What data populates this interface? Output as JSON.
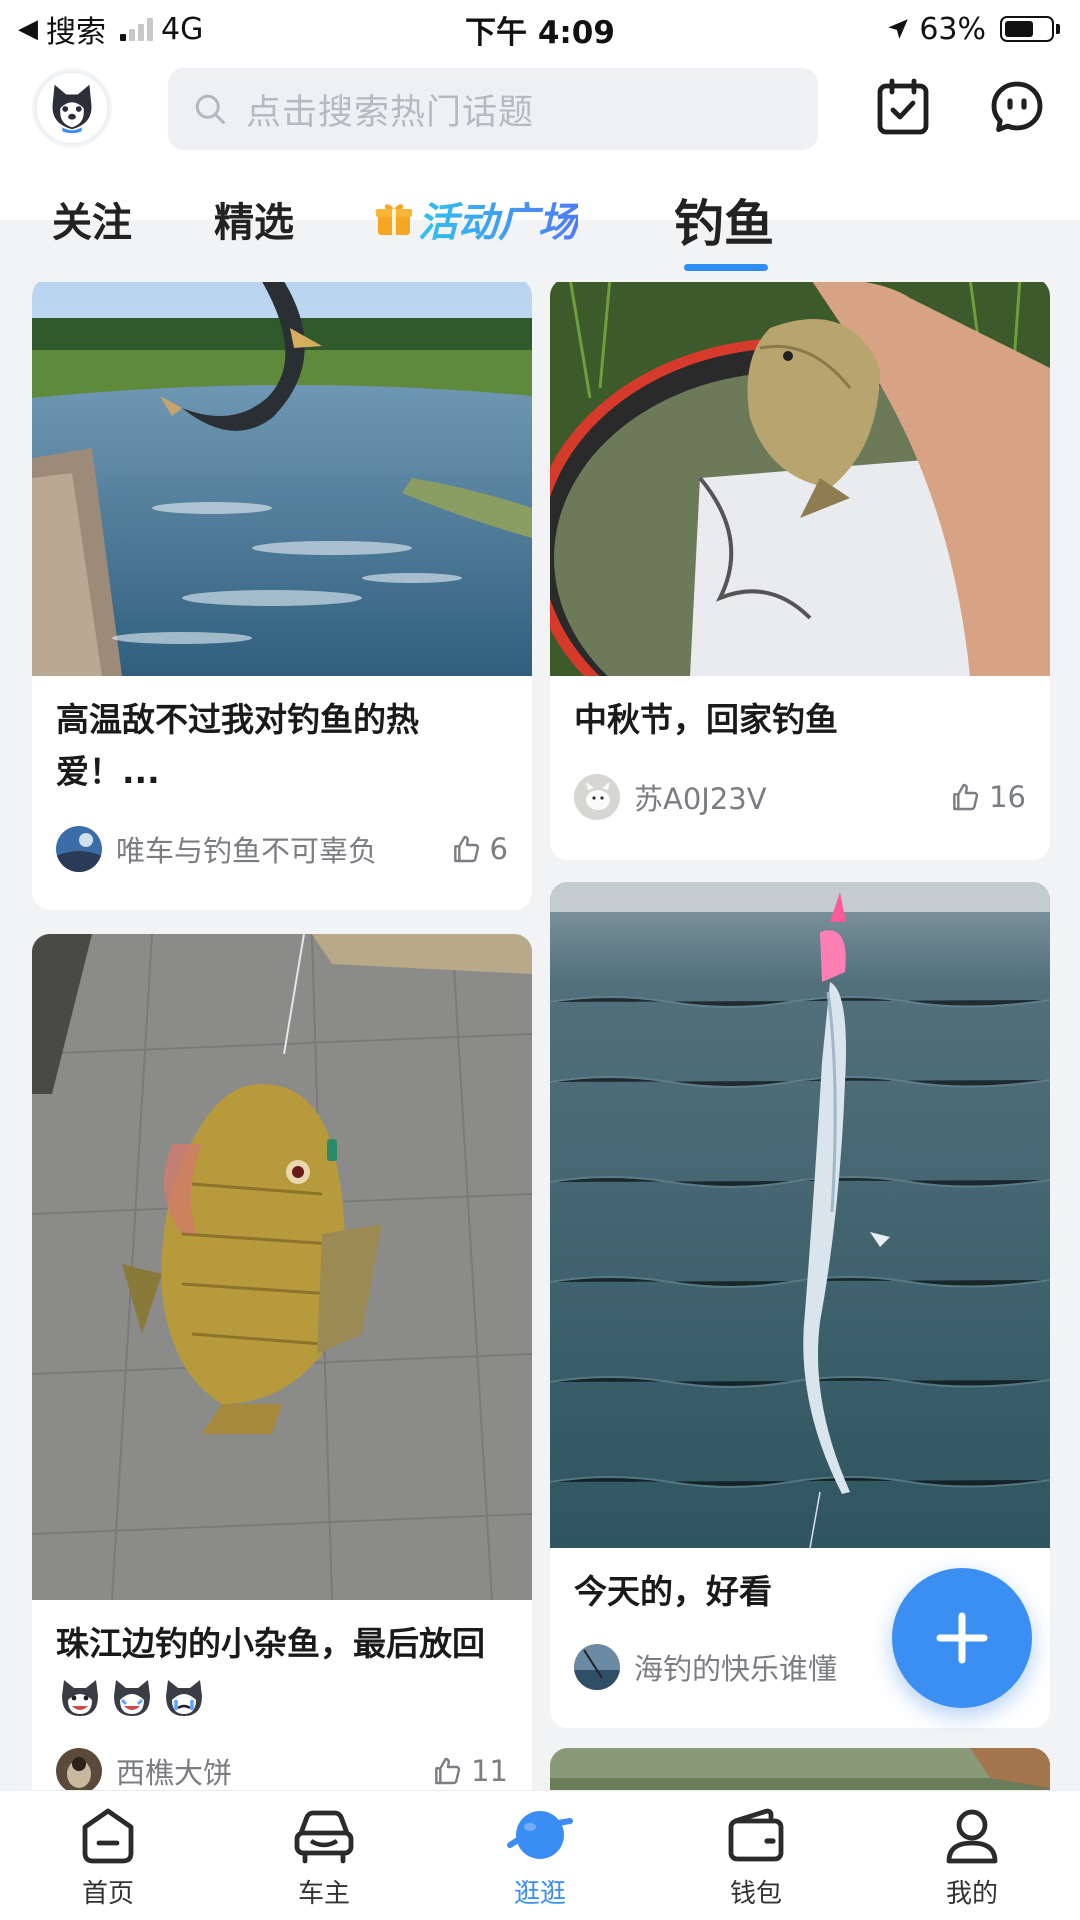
{
  "status_bar": {
    "back_app": "搜索",
    "network": "4G",
    "time": "下午 4:09",
    "battery": "63%",
    "battery_level": 0.63
  },
  "header": {
    "search_placeholder": "点击搜索热门话题"
  },
  "tabs": [
    {
      "label": "关注"
    },
    {
      "label": "精选"
    },
    {
      "label": "活动广场"
    },
    {
      "label": "钓鱼",
      "active": true
    }
  ],
  "feed": {
    "cards": [
      {
        "title": "高温敌不过我对钓鱼的热爱！...",
        "user": "唯车与钓鱼不可辜负",
        "likes": "6"
      },
      {
        "title": "中秋节，回家钓鱼",
        "user": "苏A0J23V",
        "likes": "16"
      },
      {
        "title": "珠江边钓的小杂鱼，最后放回",
        "user": "西樵大饼",
        "likes": "11"
      },
      {
        "title": "今天的，好看",
        "user": "海钓的快乐谁懂",
        "likes": ""
      }
    ]
  },
  "bottom_nav": [
    {
      "label": "首页",
      "icon": "home-icon"
    },
    {
      "label": "车主",
      "icon": "car-icon"
    },
    {
      "label": "逛逛",
      "icon": "planet-icon",
      "active": true
    },
    {
      "label": "钱包",
      "icon": "wallet-icon"
    },
    {
      "label": "我的",
      "icon": "profile-icon"
    }
  ],
  "colors": {
    "accent": "#3a8df3",
    "tab_gradient_start": "#31c1ef",
    "tab_gradient_end": "#4f7cf5",
    "gift": "#f6a623"
  }
}
